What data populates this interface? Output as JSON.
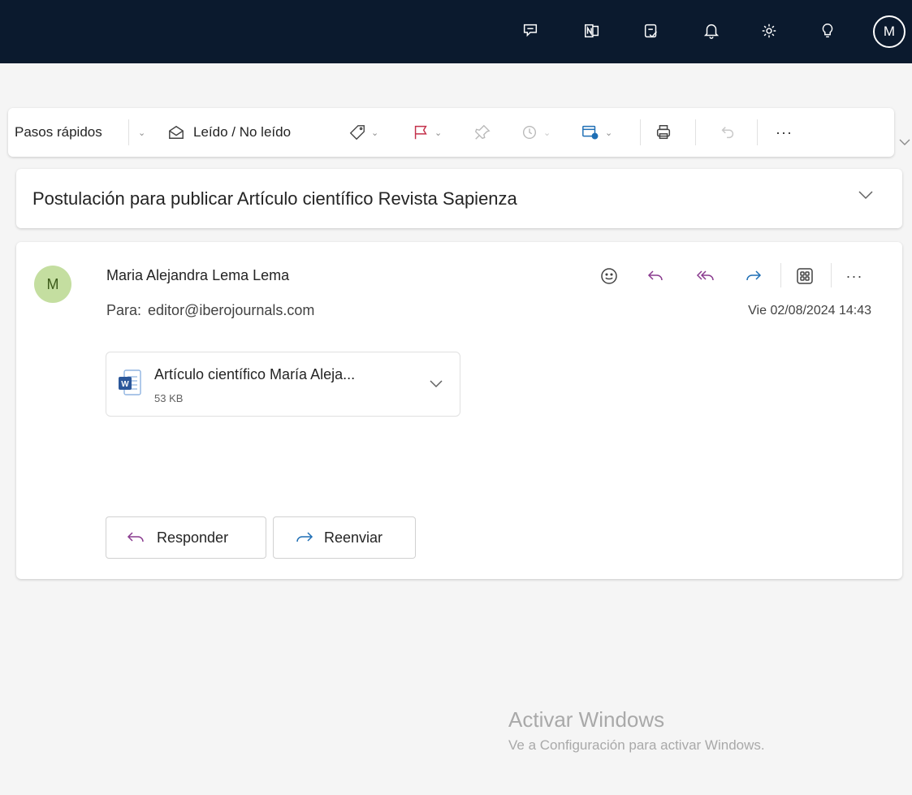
{
  "topbar": {
    "icons": [
      "feedback-chat-icon",
      "onenote-icon",
      "todo-checklist-icon",
      "bell-icon",
      "gear-icon",
      "lightbulb-icon"
    ],
    "account_initial": "M",
    "background": "#0b1a2e"
  },
  "toolbar": {
    "quick_steps_label": "Pasos rápidos",
    "read_unread_label": "Leído / No leído",
    "more_label": "···"
  },
  "subject": {
    "title": "Postulación para publicar Artículo científico Revista Sapienza"
  },
  "message": {
    "avatar_initial": "M",
    "sender": "Maria Alejandra Lema Lema",
    "to_label": "Para:",
    "to_value": "editor@iberojournals.com",
    "date": "Vie 02/08/2024 14:43",
    "more_label": "···",
    "attachment": {
      "name": "Artículo científico María Aleja...",
      "size": "53 KB"
    },
    "reply_label": "Responder",
    "forward_label": "Reenviar"
  },
  "watermark": {
    "title": "Activar Windows",
    "subtitle": "Ve a Configuración para activar Windows."
  },
  "colors": {
    "accent": "#8a3b8f",
    "flag": "#c4314b",
    "avatar_bg": "#c4dea0"
  }
}
